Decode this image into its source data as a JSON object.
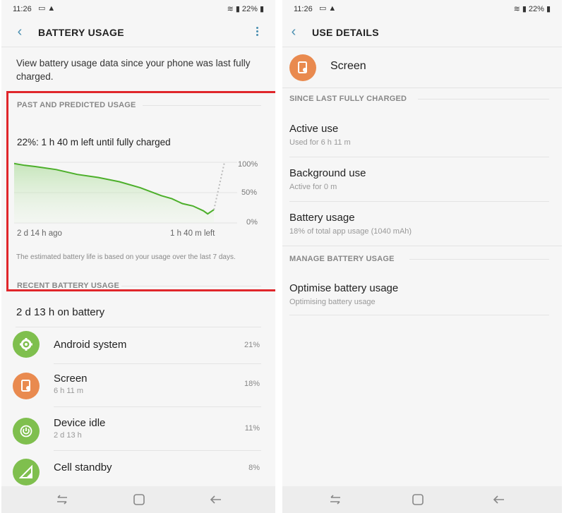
{
  "status": {
    "time": "11:26",
    "battery_pct": "22%",
    "left_icons": [
      "laptop-icon",
      "alert-icon"
    ],
    "right_icons": [
      "wifi-icon",
      "signal-icon",
      "battery-icon"
    ]
  },
  "left": {
    "title": "BATTERY USAGE",
    "intro": "View battery usage data since your phone was last fully charged.",
    "past_section": "PAST AND PREDICTED USAGE",
    "predict_text": "22%: 1 h 40 m left until fully charged",
    "chart_y_labels": [
      "100%",
      "50%",
      "0%"
    ],
    "chart_x_labels": [
      "2 d 14 h ago",
      "1 h 40 m left"
    ],
    "note": "The estimated battery life is based on your usage over the last 7 days.",
    "recent_section": "RECENT BATTERY USAGE",
    "on_battery": "2 d 13 h on battery",
    "apps": [
      {
        "name": "Android system",
        "sub": "",
        "pct": "21%",
        "color": "#7fbf4e",
        "icon": "gear-icon"
      },
      {
        "name": "Screen",
        "sub": "6 h 11 m",
        "pct": "18%",
        "color": "#e98a4f",
        "icon": "screen-icon"
      },
      {
        "name": "Device idle",
        "sub": "2 d 13 h",
        "pct": "11%",
        "color": "#7fbf4e",
        "icon": "power-icon"
      },
      {
        "name": "Cell standby",
        "sub": "",
        "pct": "8%",
        "color": "#7fbf4e",
        "icon": "cell-signal-icon"
      }
    ]
  },
  "right": {
    "title": "USE DETAILS",
    "item_name": "Screen",
    "since_section": "SINCE LAST FULLY CHARGED",
    "details": [
      {
        "name": "Active use",
        "sub": "Used for 6 h 11 m"
      },
      {
        "name": "Background use",
        "sub": "Active for 0 m"
      },
      {
        "name": "Battery usage",
        "sub": "18% of total app usage (1040 mAh)"
      }
    ],
    "manage_section": "MANAGE BATTERY USAGE",
    "optimise": {
      "name": "Optimise battery usage",
      "sub": "Optimising battery usage"
    }
  },
  "navbar": {
    "icons": [
      "recents-icon",
      "home-icon",
      "back-icon"
    ]
  },
  "colors": {
    "accent": "#4a8fb0",
    "chart_line": "#4caf2a",
    "highlight": "#e0262b",
    "green_icon": "#7fbf4e",
    "orange_icon": "#e98a4f"
  },
  "chart_data": {
    "type": "line",
    "series": [
      {
        "name": "",
        "kind": "past",
        "x": [
          0,
          0.05,
          0.1,
          0.2,
          0.3,
          0.4,
          0.5,
          0.6,
          0.7,
          0.75,
          0.8,
          0.85,
          0.9,
          0.92,
          0.95
        ],
        "y": [
          98,
          95,
          93,
          88,
          80,
          75,
          68,
          58,
          45,
          40,
          32,
          28,
          20,
          15,
          22
        ]
      },
      {
        "name": "",
        "kind": "predicted",
        "x": [
          0.95,
          1.0
        ],
        "y": [
          22,
          100
        ]
      }
    ],
    "ylim": [
      0,
      100
    ],
    "y_tick_labels": [
      "100%",
      "50%",
      "0%"
    ],
    "x_tick_labels": [
      "2 d 14 h ago",
      "1 h 40 m left"
    ]
  }
}
